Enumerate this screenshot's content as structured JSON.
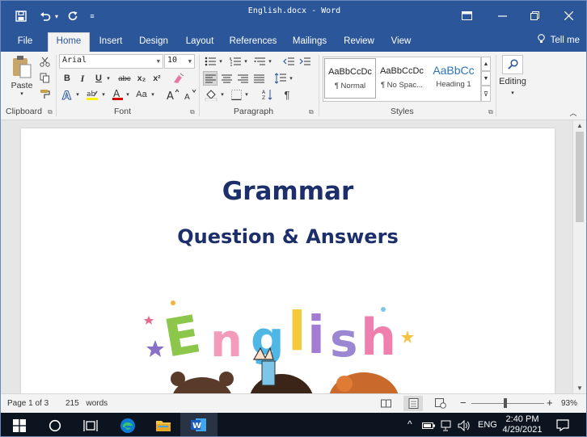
{
  "window": {
    "title": "English.docx - Word",
    "qat_icons": [
      "save-icon",
      "undo-icon",
      "redo-icon",
      "customize-qat-icon"
    ],
    "controls": [
      "ribbon-display-options-icon",
      "minimize-icon",
      "restore-icon",
      "close-icon"
    ]
  },
  "tabs": [
    "File",
    "Home",
    "Insert",
    "Design",
    "Layout",
    "References",
    "Mailings",
    "Review",
    "View"
  ],
  "active_tab": "Home",
  "tell_me": "Tell me",
  "ribbon": {
    "clipboard": {
      "label": "Clipboard",
      "paste_label": "Paste"
    },
    "font": {
      "label": "Font",
      "font_name": "Arial",
      "font_size": "10",
      "format_buttons": [
        "B",
        "I",
        "U",
        "abc",
        "x₂",
        "x²"
      ],
      "size_buttons": [
        "Aa"
      ],
      "colors": {
        "font_color": "#d40000",
        "highlight": "#fff200"
      }
    },
    "paragraph": {
      "label": "Paragraph"
    },
    "styles": {
      "label": "Styles",
      "items": [
        {
          "sample": "AaBbCcDc",
          "name": "¶ Normal"
        },
        {
          "sample": "AaBbCcDc",
          "name": "¶ No Spac..."
        },
        {
          "sample": "AaBbCc",
          "name": "Heading 1"
        }
      ]
    },
    "editing": {
      "label": "Editing"
    }
  },
  "document": {
    "heading": "Grammar",
    "subheading": "Question & Answers",
    "art_text": "English",
    "heading_color": "#1c2f6a"
  },
  "status": {
    "page": "Page 1 of 3",
    "words_count": "215",
    "words_label": "words",
    "zoom_minus": "−",
    "zoom_plus": "+",
    "zoom": "93%"
  },
  "taskbar": {
    "apps": [
      "windows-start-icon",
      "search-circle-icon",
      "task-view-icon",
      "edge-icon",
      "file-explorer-icon",
      "word-icon"
    ],
    "caret": "^",
    "language": "ENG",
    "time": "2:40 PM",
    "date": "4/29/2021"
  }
}
